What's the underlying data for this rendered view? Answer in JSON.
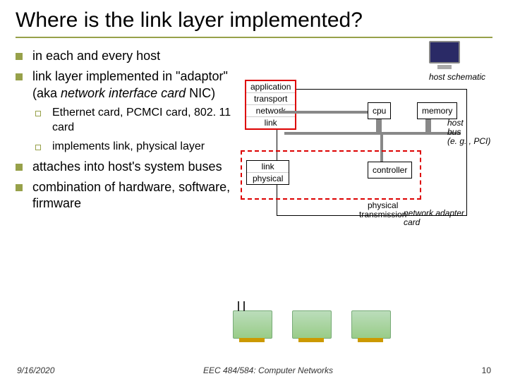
{
  "title": "Where is the link layer implemented?",
  "bullets": {
    "b1": "in each and every host",
    "b2_pre": "link layer implemented in \"adaptor\" (aka ",
    "b2_em": "network interface card",
    "b2_post": " NIC)",
    "s1": "Ethernet card, PCMCI card, 802. 11 card",
    "s2": "implements link, physical layer",
    "b3": "attaches into host's system buses",
    "b4": "combination of hardware, software, firmware"
  },
  "diagram": {
    "host_schematic": "host schematic",
    "stack1": {
      "a": "application",
      "b": "transport",
      "c": "network",
      "d": "link"
    },
    "cpu": "cpu",
    "memory": "memory",
    "controller": "controller",
    "stack2": {
      "a": "link",
      "b": "physical"
    },
    "phys_trans_1": "physical",
    "phys_trans_2": "transmission",
    "bus1": "host",
    "bus2": "bus",
    "bus3": "(e. g. , PCI)",
    "nic_lbl_1": "network adapter",
    "nic_lbl_2": "card"
  },
  "footer": {
    "date": "9/16/2020",
    "course": "EEC 484/584: Computer Networks",
    "page": "10"
  }
}
